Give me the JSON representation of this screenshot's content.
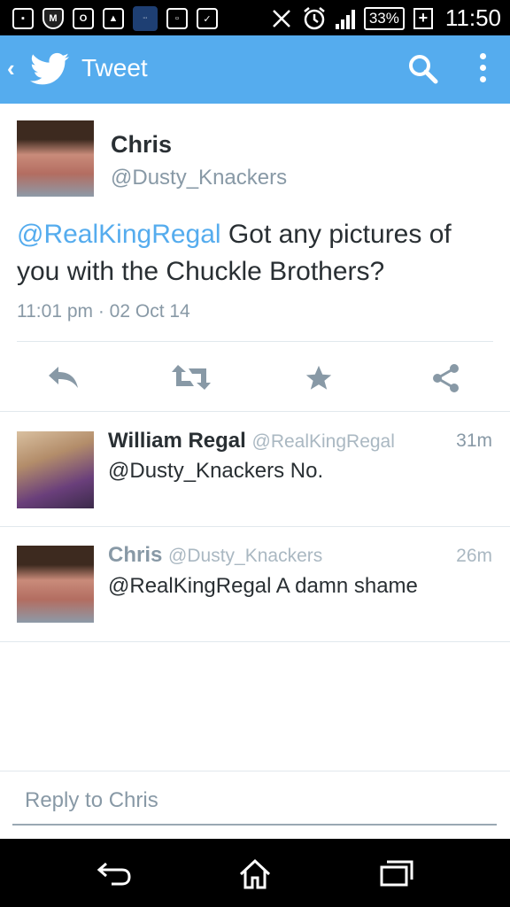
{
  "status_bar": {
    "battery": "33%",
    "battery_plus": "+",
    "time": "11:50",
    "icons": [
      "message-icon",
      "mcafee-icon",
      "outlook-icon",
      "gallery-icon",
      "lounge-icon",
      "screen-icon",
      "briefcase-icon",
      "no-signal-icon",
      "alarm-icon",
      "signal-icon"
    ]
  },
  "action_bar": {
    "title": "Tweet",
    "back": "‹"
  },
  "tweet": {
    "name": "Chris",
    "handle": "@Dusty_Knackers",
    "mention": "@RealKingRegal",
    "text": " Got any pictures of you with the Chuckle Brothers?",
    "timestamp": "11:01 pm · 02 Oct 14"
  },
  "replies": [
    {
      "name": "William Regal",
      "handle": "@RealKingRegal",
      "time": "31m",
      "text": "@Dusty_Knackers No."
    },
    {
      "name": "Chris",
      "handle": "@Dusty_Knackers",
      "time": "26m",
      "text": "@RealKingRegal A damn shame"
    }
  ],
  "reply_box": {
    "placeholder": "Reply to Chris"
  },
  "colors": {
    "twitter_blue": "#55acee",
    "text": "#292f33",
    "muted": "#8899a6"
  }
}
